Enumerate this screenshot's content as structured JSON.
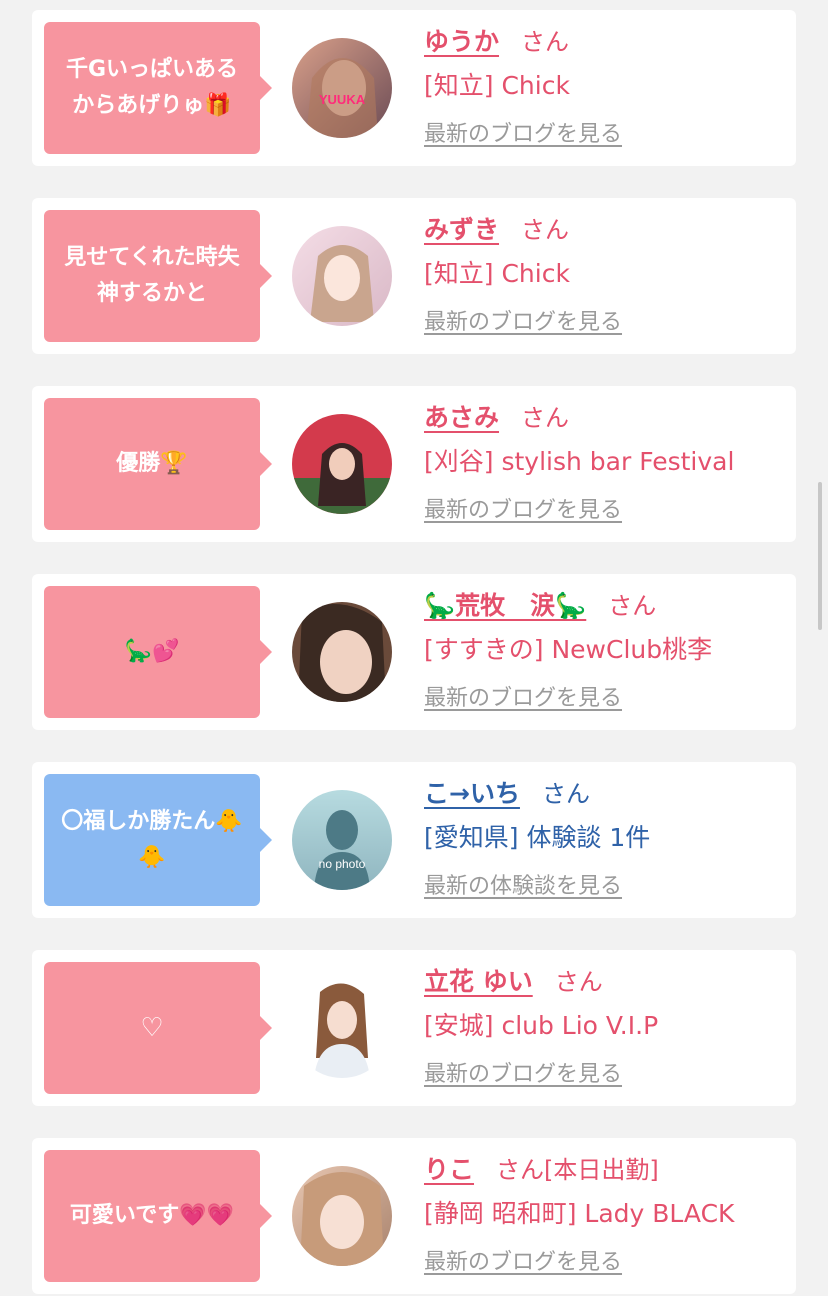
{
  "cards": [
    {
      "bubble": "千Gいっぱいあるからあげりゅ🎁",
      "name": "ゆうか",
      "honorific": "さん",
      "shop": "[知立] Chick",
      "link": "最新のブログを見る",
      "avatar_text": "YUUKA"
    },
    {
      "bubble": "見せてくれた時失神するかと",
      "name": "みずき",
      "honorific": "さん",
      "shop": "[知立] Chick",
      "link": "最新のブログを見る"
    },
    {
      "bubble": "優勝🏆",
      "name": "あさみ",
      "honorific": "さん",
      "shop": "[刈谷] stylish bar Festival",
      "link": "最新のブログを見る"
    },
    {
      "bubble": "🦕💕",
      "name": "🦕荒牧　涙🦕",
      "honorific": "さん",
      "shop": "[すすきの] NewClub桃李",
      "link": "最新のブログを見る"
    },
    {
      "bubble": "〇福しか勝たん🐥🐥",
      "name": "こ→いち",
      "honorific": "さん",
      "shop": "[愛知県] 体験談 1件",
      "link": "最新の体験談を見る",
      "avatar_text": "no photo"
    },
    {
      "bubble": "♡",
      "name": "立花 ゆい",
      "honorific": "さん",
      "shop": "[安城] club Lio V.I.P",
      "link": "最新のブログを見る"
    },
    {
      "bubble": "可愛いです💗💗",
      "name": "りこ",
      "honorific": "さん[本日出勤]",
      "shop": "[静岡 昭和町] Lady BLACK",
      "link": "最新のブログを見る"
    }
  ],
  "colors": {
    "pink_bubble": "#f7959f",
    "blue_bubble": "#8ab9f2",
    "pink_text": "#e4506c",
    "blue_text": "#2f62a8",
    "link_gray": "#9a9a9a",
    "page_bg": "#f2f2f2"
  }
}
